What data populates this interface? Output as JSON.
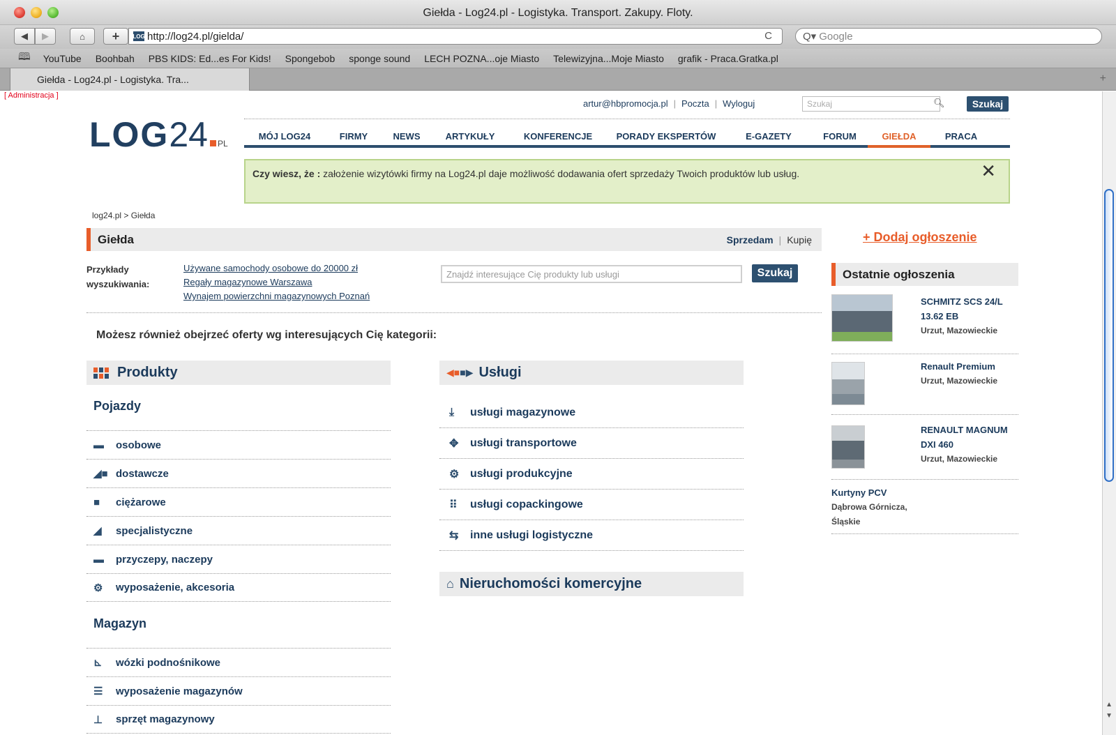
{
  "window": {
    "title": "Giełda - Log24.pl - Logistyka. Transport. Zakupy. Floty.",
    "url": "http://log24.pl/gielda/",
    "search_placeholder": "Google",
    "reload_symbol": "C",
    "add_symbol": "+",
    "favicon_text": "LOG"
  },
  "bookmarks": [
    "YouTube",
    "Boohbah",
    "PBS KIDS: Ed...es For Kids!",
    "Spongebob",
    "sponge sound",
    "LECH POZNA...oje Miasto",
    "Telewizyjna...Moje Miasto",
    "grafik - Praca.Gratka.pl"
  ],
  "tab": {
    "label": "Giełda - Log24.pl - Logistyka. Tra..."
  },
  "admin_link": "[ Administracja ]",
  "logo": {
    "log": "LOG",
    "num": "24",
    "suffix": "PL"
  },
  "toplinks": {
    "email": "artur@hbpromocja.pl",
    "mail": "Poczta",
    "logout": "Wyloguj",
    "search_placeholder": "Szukaj",
    "search_button": "Szukaj"
  },
  "nav": [
    "MÓJ LOG24",
    "FIRMY",
    "NEWS",
    "ARTYKUŁY",
    "KONFERENCJE",
    "PORADY EKSPERTÓW",
    "E-GAZETY",
    "FORUM",
    "GIEŁDA",
    "PRACA"
  ],
  "nav_active": "GIEŁDA",
  "notice": {
    "lead": "Czy wiesz, że :",
    "text": " założenie wizytówki firmy na Log24.pl daje możliwość dodawania ofert sprzedaży Twoich produktów lub usług."
  },
  "breadcrumb": "log24.pl > Giełda",
  "section": {
    "title": "Giełda",
    "sell": "Sprzedam",
    "buy": "Kupię"
  },
  "examples": {
    "label1": "Przykłady",
    "label2": "wyszukiwania:",
    "links": [
      "Używane samochody osobowe do 20000 zł",
      "Regały magazynowe Warszawa",
      "Wynajem powierzchni magazynowych Poznań"
    ]
  },
  "main_search": {
    "placeholder": "Znajdź interesujące Cię produkty lub usługi",
    "button": "Szukaj"
  },
  "categories_intro": "Możesz również obejrzeć oferty wg interesujących Cię kategorii:",
  "products": {
    "title": "Produkty",
    "vehicles_title": "Pojazdy",
    "vehicles": [
      {
        "label": "osobowe",
        "icon": "car-icon"
      },
      {
        "label": "dostawcze",
        "icon": "van-icon"
      },
      {
        "label": "ciężarowe",
        "icon": "truck-icon"
      },
      {
        "label": "specjalistyczne",
        "icon": "special-vehicle-icon"
      },
      {
        "label": "przyczepy, naczepy",
        "icon": "trailer-icon"
      },
      {
        "label": "wyposażenie, akcesoria",
        "icon": "gear-icon"
      }
    ],
    "warehouse_title": "Magazyn",
    "warehouse": [
      {
        "label": "wózki podnośnikowe",
        "icon": "forklift-icon"
      },
      {
        "label": "wyposażenie magazynów",
        "icon": "shelving-icon"
      },
      {
        "label": "sprzęt magazynowy",
        "icon": "pallet-jack-icon"
      }
    ]
  },
  "services": {
    "title": "Usługi",
    "items": [
      {
        "label": "usługi magazynowe",
        "icon": "download-icon"
      },
      {
        "label": "usługi transportowe",
        "icon": "move-arrows-icon"
      },
      {
        "label": "usługi produkcyjne",
        "icon": "gears-icon"
      },
      {
        "label": "usługi copackingowe",
        "icon": "grid-dots-icon"
      },
      {
        "label": "inne usługi logistyczne",
        "icon": "exchange-arrows-icon"
      }
    ]
  },
  "real_estate": {
    "title": "Nieruchomości komercyjne"
  },
  "sidebar": {
    "add_ad": "+ Dodaj ogłoszenie",
    "recent_title": "Ostatnie ogłoszenia",
    "ads": [
      {
        "title": "SCHMITZ SCS 24/L 13.62 EB",
        "location": "Urzut, Mazowieckie"
      },
      {
        "title": "Renault Premium",
        "location": "Urzut, Mazowieckie"
      },
      {
        "title": "RENAULT MAGNUM DXI 460",
        "location": "Urzut, Mazowieckie"
      },
      {
        "title": "Kurtyny PCV",
        "location": "Dąbrowa Górnicza, Śląskie"
      }
    ]
  },
  "colors": {
    "brand_navy": "#213f60",
    "accent_orange": "#e85d2a",
    "notice_bg": "#e3efc9"
  }
}
